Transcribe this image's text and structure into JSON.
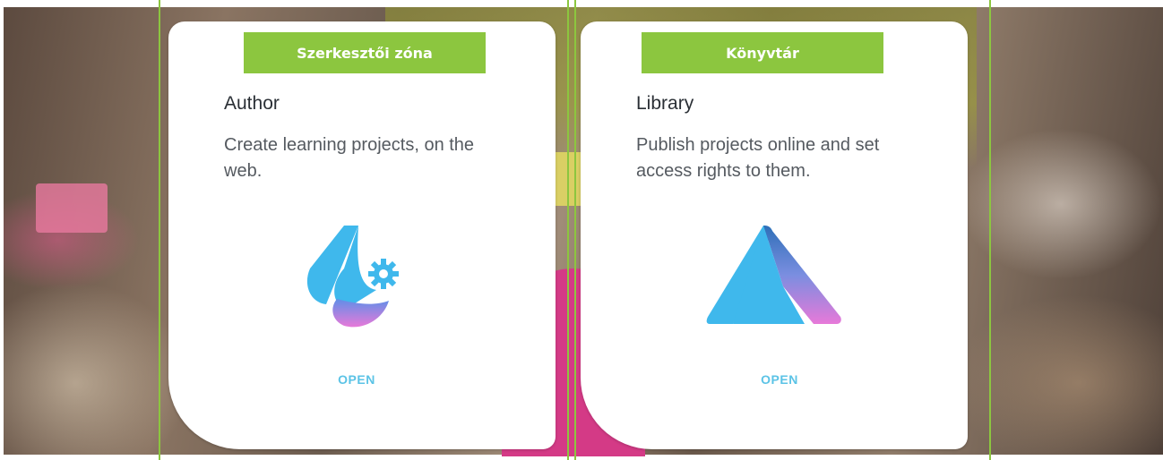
{
  "cards": [
    {
      "badge": "Szerkesztői zóna",
      "title": "Author",
      "description": "Create learning projects, on the web.",
      "action": "OPEN",
      "icon": "author-logo-icon"
    },
    {
      "badge": "Könyvtár",
      "title": "Library",
      "description": "Publish projects online and set access rights to them.",
      "action": "OPEN",
      "icon": "library-logo-icon"
    }
  ],
  "colors": {
    "accent_green": "#8cc63f",
    "link_blue": "#5bc3e6",
    "logo_blue": "#3fb8ec",
    "logo_pink": "#e779d9",
    "card_bg": "#ffffff"
  }
}
